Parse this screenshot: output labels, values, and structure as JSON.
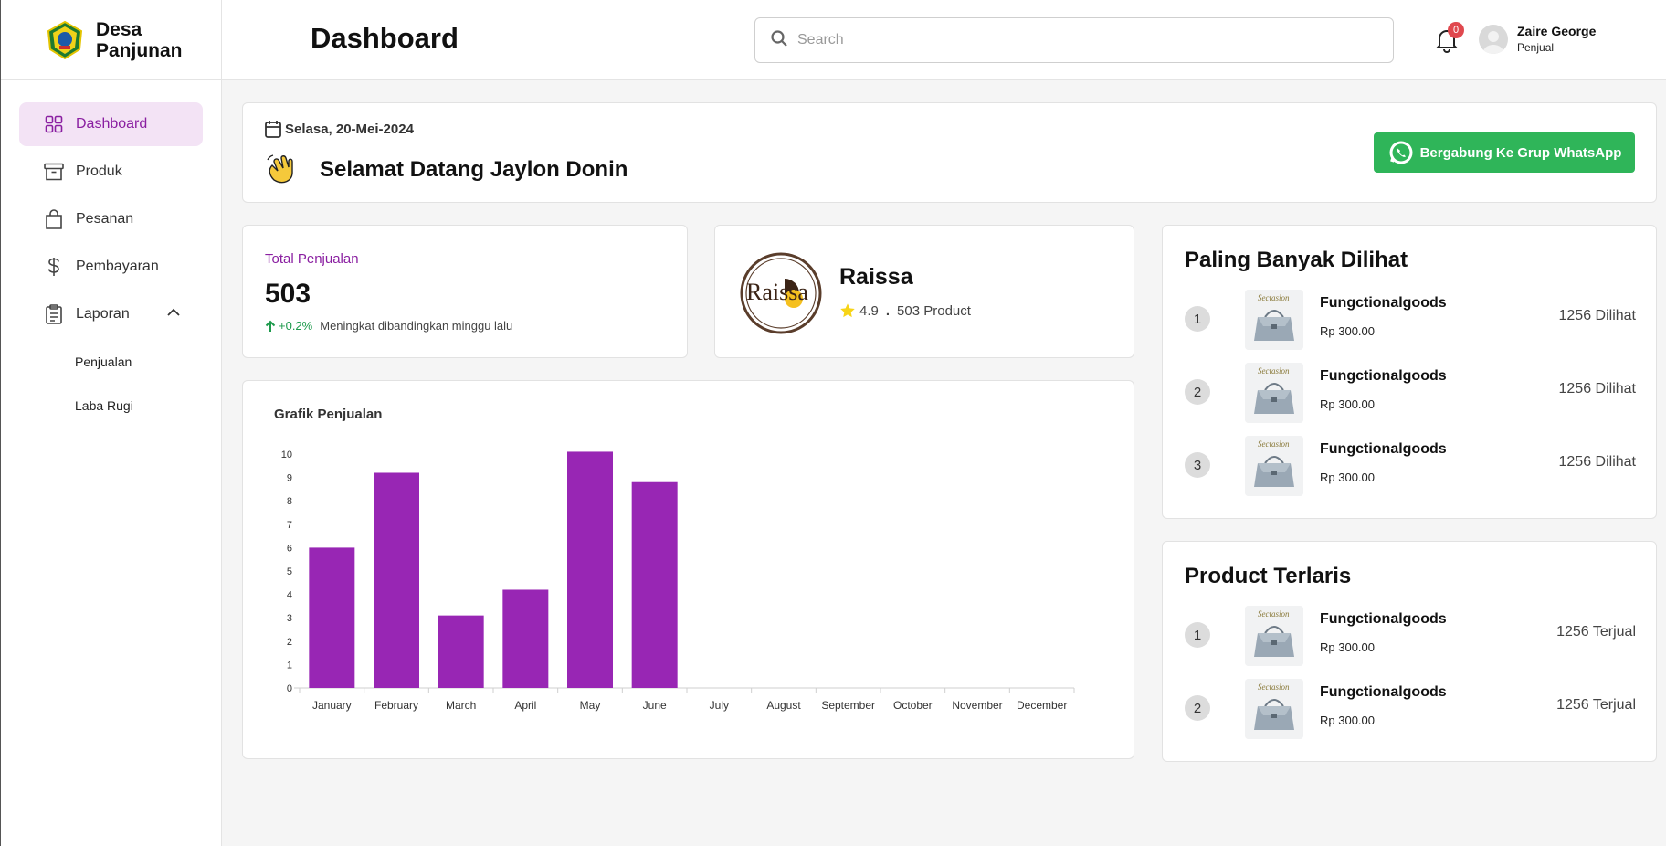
{
  "brand": {
    "name_line1": "Desa",
    "name_line2": "Panjunan"
  },
  "header": {
    "title": "Dashboard",
    "search_placeholder": "Search",
    "notification_count": "0",
    "user_name": "Zaire George",
    "user_role": "Penjual"
  },
  "sidebar": {
    "items": [
      {
        "label": "Dashboard",
        "icon": "grid-icon",
        "active": true
      },
      {
        "label": "Produk",
        "icon": "archive-icon"
      },
      {
        "label": "Pesanan",
        "icon": "shopping-bag-icon"
      },
      {
        "label": "Pembayaran",
        "icon": "dollar-icon"
      },
      {
        "label": "Laporan",
        "icon": "clipboard-icon",
        "expanded": true
      }
    ],
    "sub_items": [
      {
        "label": "Penjualan"
      },
      {
        "label": "Laba Rugi"
      }
    ]
  },
  "welcome": {
    "date": "Selasa, 20-Mei-2024",
    "greeting": "Selamat Datang Jaylon Donin",
    "whatsapp_button": "Bergabung Ke Grup WhatsApp"
  },
  "stats": {
    "label": "Total Penjualan",
    "value": "503",
    "change": "+0.2%",
    "change_text": "Meningkat dibandingkan minggu lalu"
  },
  "store": {
    "name": "Raissa",
    "rating": "4.9",
    "products": "503 Product"
  },
  "chart_data": {
    "type": "bar",
    "title": "Grafik Penjualan",
    "categories": [
      "January",
      "February",
      "March",
      "April",
      "May",
      "June",
      "July",
      "August",
      "September",
      "October",
      "November",
      "December"
    ],
    "values": [
      6,
      9.2,
      3.1,
      4.2,
      10.1,
      8.8,
      0,
      0,
      0,
      0,
      0,
      0
    ],
    "ylim": [
      0,
      10
    ],
    "yticks": [
      "0",
      "1",
      "2",
      "3",
      "4",
      "5",
      "6",
      "7",
      "8",
      "9",
      "10"
    ],
    "color": "#9826b4",
    "grid": false
  },
  "most_viewed": {
    "title": "Paling Banyak Dilihat",
    "items": [
      {
        "rank": "1",
        "name": "Fungctionalgoods",
        "price": "Rp 300.00",
        "metric": "1256 Dilihat"
      },
      {
        "rank": "2",
        "name": "Fungctionalgoods",
        "price": "Rp 300.00",
        "metric": "1256 Dilihat"
      },
      {
        "rank": "3",
        "name": "Fungctionalgoods",
        "price": "Rp 300.00",
        "metric": "1256 Dilihat"
      }
    ]
  },
  "best_selling": {
    "title": "Product Terlaris",
    "items": [
      {
        "rank": "1",
        "name": "Fungctionalgoods",
        "price": "Rp 300.00",
        "metric": "1256 Terjual"
      },
      {
        "rank": "2",
        "name": "Fungctionalgoods",
        "price": "Rp 300.00",
        "metric": "1256 Terjual"
      }
    ]
  },
  "colors": {
    "accent": "#8a1fa1",
    "active_bg": "#f3e3f5",
    "whatsapp": "#2fb559",
    "positive": "#1d9a4c",
    "bar": "#9826b4"
  }
}
